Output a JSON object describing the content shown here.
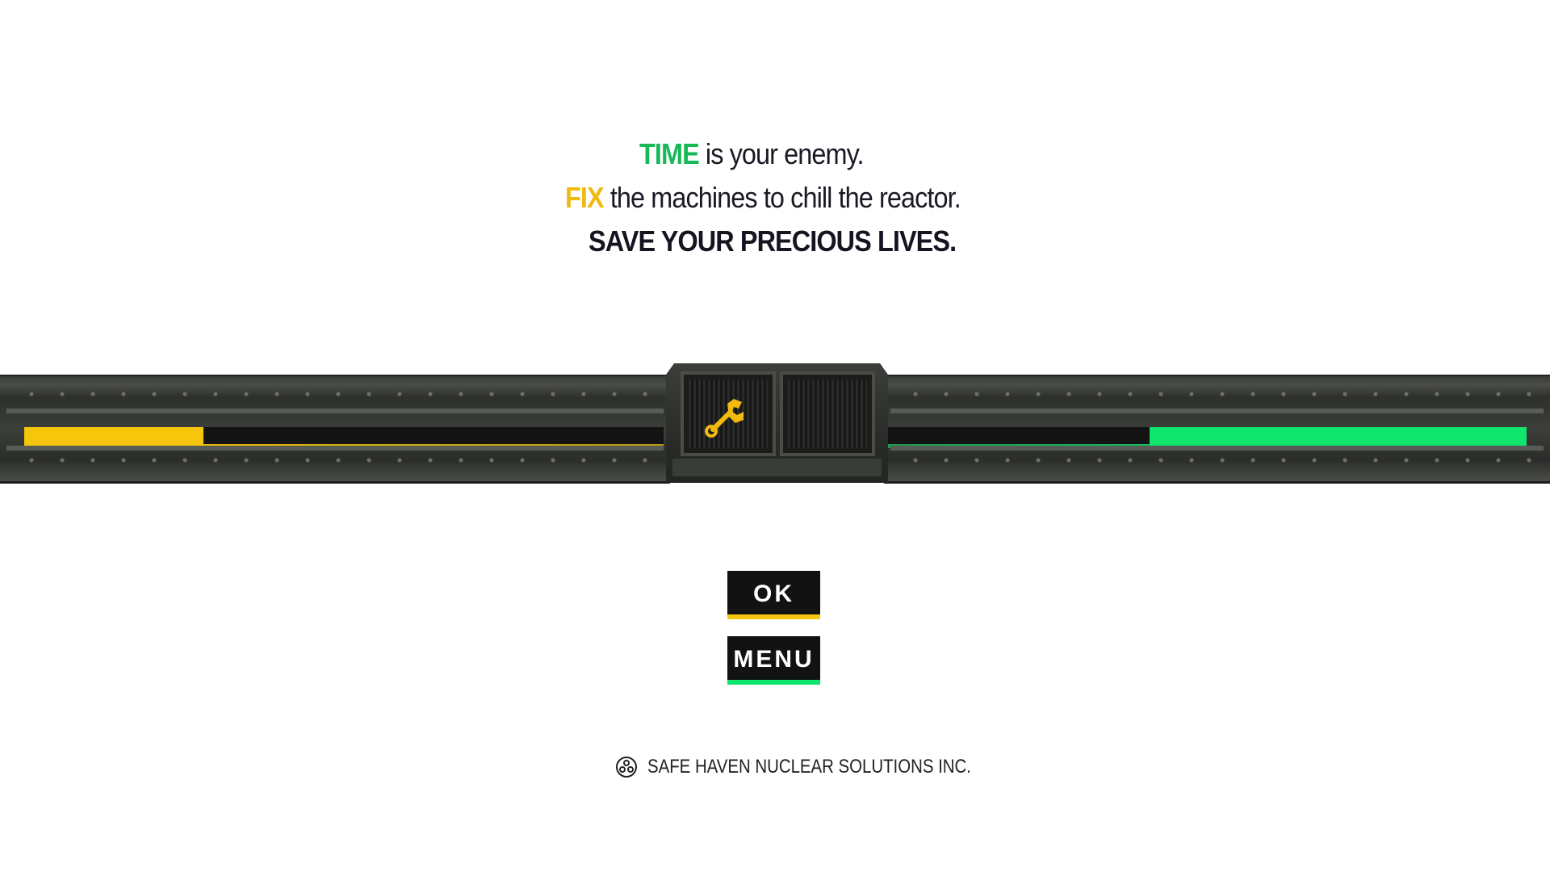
{
  "intro": {
    "line1_keyword": "TIME",
    "line1_rest": " is your enemy.",
    "line2_keyword": "FIX",
    "line2_rest": " the machines to chill the reactor.",
    "line3": "SAVE YOUR PRECIOUS LIVES."
  },
  "meters": {
    "left_yellow_fill": 0.28,
    "right_green_fill": 0.59,
    "yellow_color": "#f6c60d",
    "green_color": "#0ee66e"
  },
  "hub": {
    "slot1_icon": "wrench-icon",
    "slot2_icon": "empty"
  },
  "buttons": {
    "ok_label": "OK",
    "menu_label": "MENU"
  },
  "footer": {
    "company": "SAFE HAVEN NUCLEAR SOLUTIONS INC.",
    "logo_icon": "nuclear-logo-icon"
  }
}
